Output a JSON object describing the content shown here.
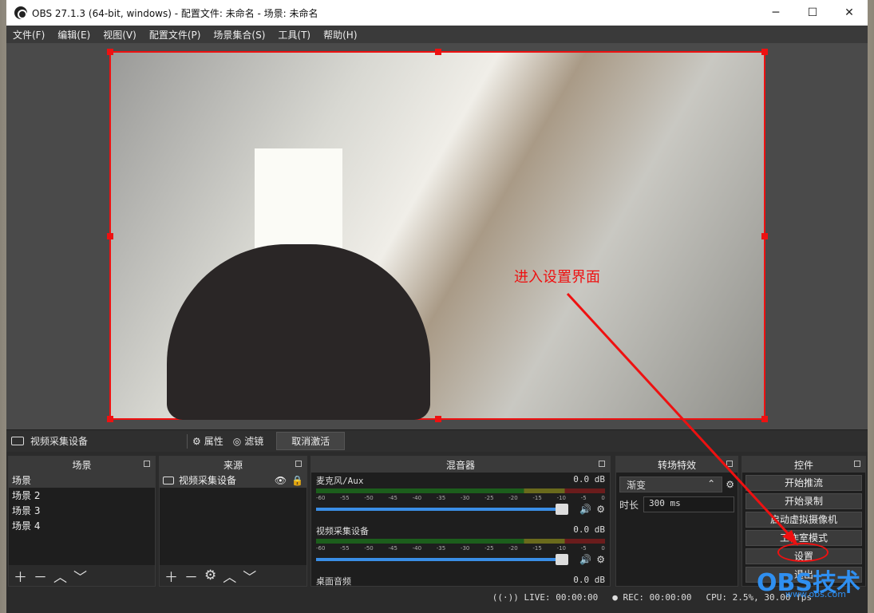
{
  "window": {
    "title": "OBS 27.1.3 (64-bit, windows) - 配置文件: 未命名 - 场景: 未命名",
    "min": "─",
    "max": "☐",
    "close": "✕"
  },
  "menu": [
    "文件(F)",
    "编辑(E)",
    "视图(V)",
    "配置文件(P)",
    "场景集合(S)",
    "工具(T)",
    "帮助(H)"
  ],
  "annotation": {
    "label": "进入设置界面"
  },
  "source_bar": {
    "name": "视频采集设备",
    "properties": "属性",
    "filters": "滤镜",
    "deactivate": "取消激活"
  },
  "scenes": {
    "title": "场景",
    "items": [
      "场景",
      "场景 2",
      "场景 3",
      "场景 4"
    ]
  },
  "sources": {
    "title": "来源",
    "items": [
      "视频采集设备"
    ]
  },
  "mixer": {
    "title": "混音器",
    "ticks": [
      "-60",
      "-55",
      "-50",
      "-45",
      "-40",
      "-35",
      "-30",
      "-25",
      "-20",
      "-15",
      "-10",
      "-5",
      "0"
    ],
    "tracks": [
      {
        "name": "麦克风/Aux",
        "db": "0.0 dB"
      },
      {
        "name": "视频采集设备",
        "db": "0.0 dB"
      },
      {
        "name": "桌面音频",
        "db": "0.0 dB"
      }
    ]
  },
  "transitions": {
    "title": "转场特效",
    "type": "渐变",
    "duration_label": "时长",
    "duration": "300 ms"
  },
  "controls": {
    "title": "控件",
    "buttons": [
      "开始推流",
      "开始录制",
      "启动虚拟摄像机",
      "工作室模式",
      "设置",
      "退出"
    ]
  },
  "status": {
    "live": "LIVE: 00:00:00",
    "rec": "REC: 00:00:00",
    "cpu": "CPU: 2.5%, 30.00 fps"
  },
  "watermark": {
    "text": "OBS技术",
    "sub": "www.obs.com"
  }
}
